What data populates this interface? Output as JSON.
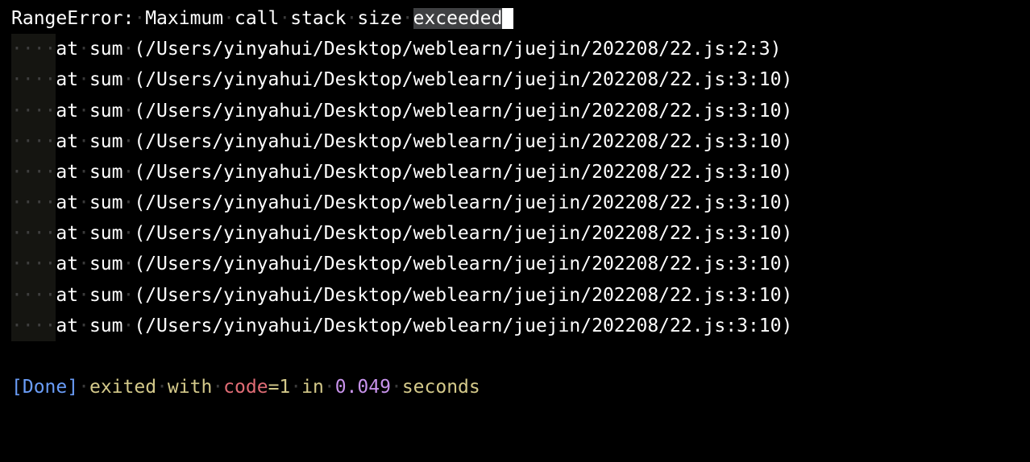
{
  "error": {
    "type": "RangeError:",
    "message_part1": "Maximum call stack size",
    "message_highlighted": "exceeded"
  },
  "indent": "····",
  "stack": [
    {
      "at": "at",
      "func": "sum",
      "path": "(/Users/yinyahui/Desktop/weblearn/juejin/202208/22.js:2:3)"
    },
    {
      "at": "at",
      "func": "sum",
      "path": "(/Users/yinyahui/Desktop/weblearn/juejin/202208/22.js:3:10)"
    },
    {
      "at": "at",
      "func": "sum",
      "path": "(/Users/yinyahui/Desktop/weblearn/juejin/202208/22.js:3:10)"
    },
    {
      "at": "at",
      "func": "sum",
      "path": "(/Users/yinyahui/Desktop/weblearn/juejin/202208/22.js:3:10)"
    },
    {
      "at": "at",
      "func": "sum",
      "path": "(/Users/yinyahui/Desktop/weblearn/juejin/202208/22.js:3:10)"
    },
    {
      "at": "at",
      "func": "sum",
      "path": "(/Users/yinyahui/Desktop/weblearn/juejin/202208/22.js:3:10)"
    },
    {
      "at": "at",
      "func": "sum",
      "path": "(/Users/yinyahui/Desktop/weblearn/juejin/202208/22.js:3:10)"
    },
    {
      "at": "at",
      "func": "sum",
      "path": "(/Users/yinyahui/Desktop/weblearn/juejin/202208/22.js:3:10)"
    },
    {
      "at": "at",
      "func": "sum",
      "path": "(/Users/yinyahui/Desktop/weblearn/juejin/202208/22.js:3:10)"
    },
    {
      "at": "at",
      "func": "sum",
      "path": "(/Users/yinyahui/Desktop/weblearn/juejin/202208/22.js:3:10)"
    }
  ],
  "status": {
    "bracket_open": "[",
    "done": "Done",
    "bracket_close": "]",
    "exited_with": "exited with",
    "code_key": "code",
    "equals": "=",
    "code_val": "1",
    "in_word": "in",
    "time_val": "0.049",
    "seconds": "seconds"
  },
  "ws_dot": "·"
}
